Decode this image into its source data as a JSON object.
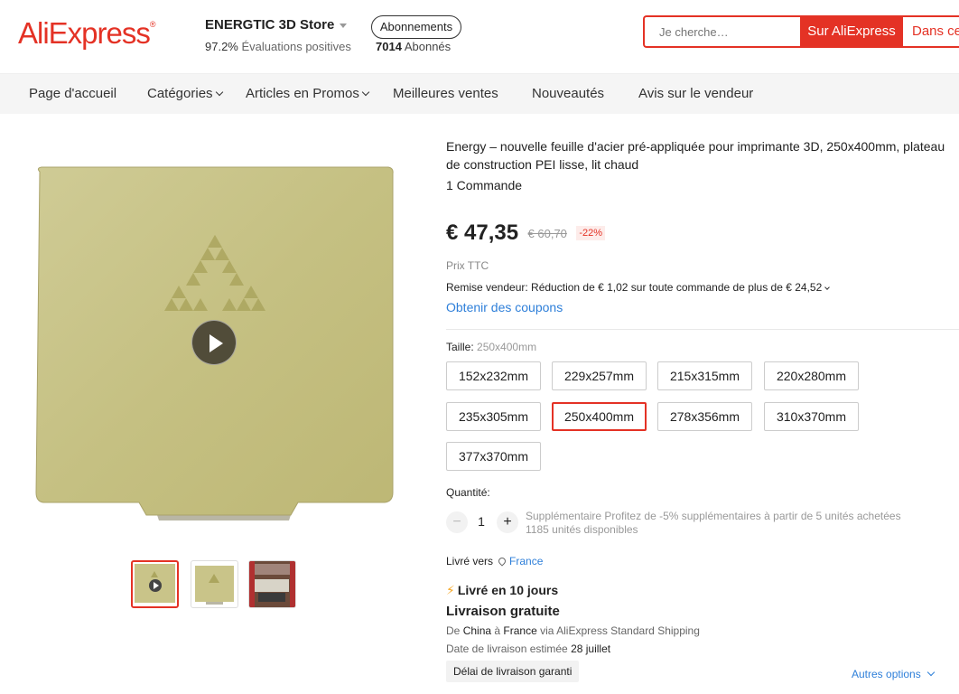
{
  "header": {
    "logo": "AliExpress",
    "store_name": "ENERGTIC 3D Store",
    "rating_value": "97.2%",
    "rating_label": "Évaluations positives",
    "follow_label": "Abonnements",
    "followers_count": "7014",
    "followers_label": "Abonnés",
    "search_placeholder": "Je cherche…",
    "search_ali_label": "Sur AliExpress",
    "search_store_label": "Dans ce"
  },
  "nav": {
    "items": [
      "Page d'accueil",
      "Catégories",
      "Articles en Promos",
      "Meilleures ventes",
      "Nouveautés",
      "Avis sur le vendeur"
    ]
  },
  "product": {
    "title": "Energy – nouvelle feuille d'acier pré-appliquée pour imprimante 3D, 250x400mm, plateau de construction PEI lisse, lit chaud",
    "orders": "1 Commande",
    "price": "€ 47,35",
    "old_price": "€ 60,70",
    "discount": "-22%",
    "price_note": "Prix TTC",
    "seller_discount": "Remise vendeur: Réduction de € 1,02 sur toute commande de plus de € 24,52",
    "coupons_link": "Obtenir des coupons",
    "size_label": "Taille:",
    "size_selected": "250x400mm",
    "sizes": [
      "152x232mm",
      "229x257mm",
      "215x315mm",
      "220x280mm",
      "235x305mm",
      "250x400mm",
      "278x356mm",
      "310x370mm",
      "377x370mm"
    ],
    "quantity_label": "Quantité:",
    "quantity": "1",
    "qty_minus": "−",
    "qty_plus": "+",
    "qty_promo": "Supplémentaire Profitez de -5% supplémentaires à partir de 5 unités achetées",
    "qty_available": "1185 unités disponibles"
  },
  "shipping": {
    "ship_to_label": "Livré vers",
    "ship_to_country": "France",
    "delivery_time": "Livré en 10 jours",
    "free_shipping": "Livraison gratuite",
    "from_prefix": "De",
    "from_country": "China",
    "to_prefix": "à",
    "to_country": "France",
    "via_text": "via AliExpress Standard Shipping",
    "estimated_label": "Date de livraison estimée",
    "estimated_date": "28 juillet",
    "guarantee": "Délai de livraison garanti",
    "more_options": "Autres options"
  },
  "colors": {
    "brand_red": "#e43225",
    "link_blue": "#2e7fd9",
    "plate_gold": "#c9c489"
  }
}
